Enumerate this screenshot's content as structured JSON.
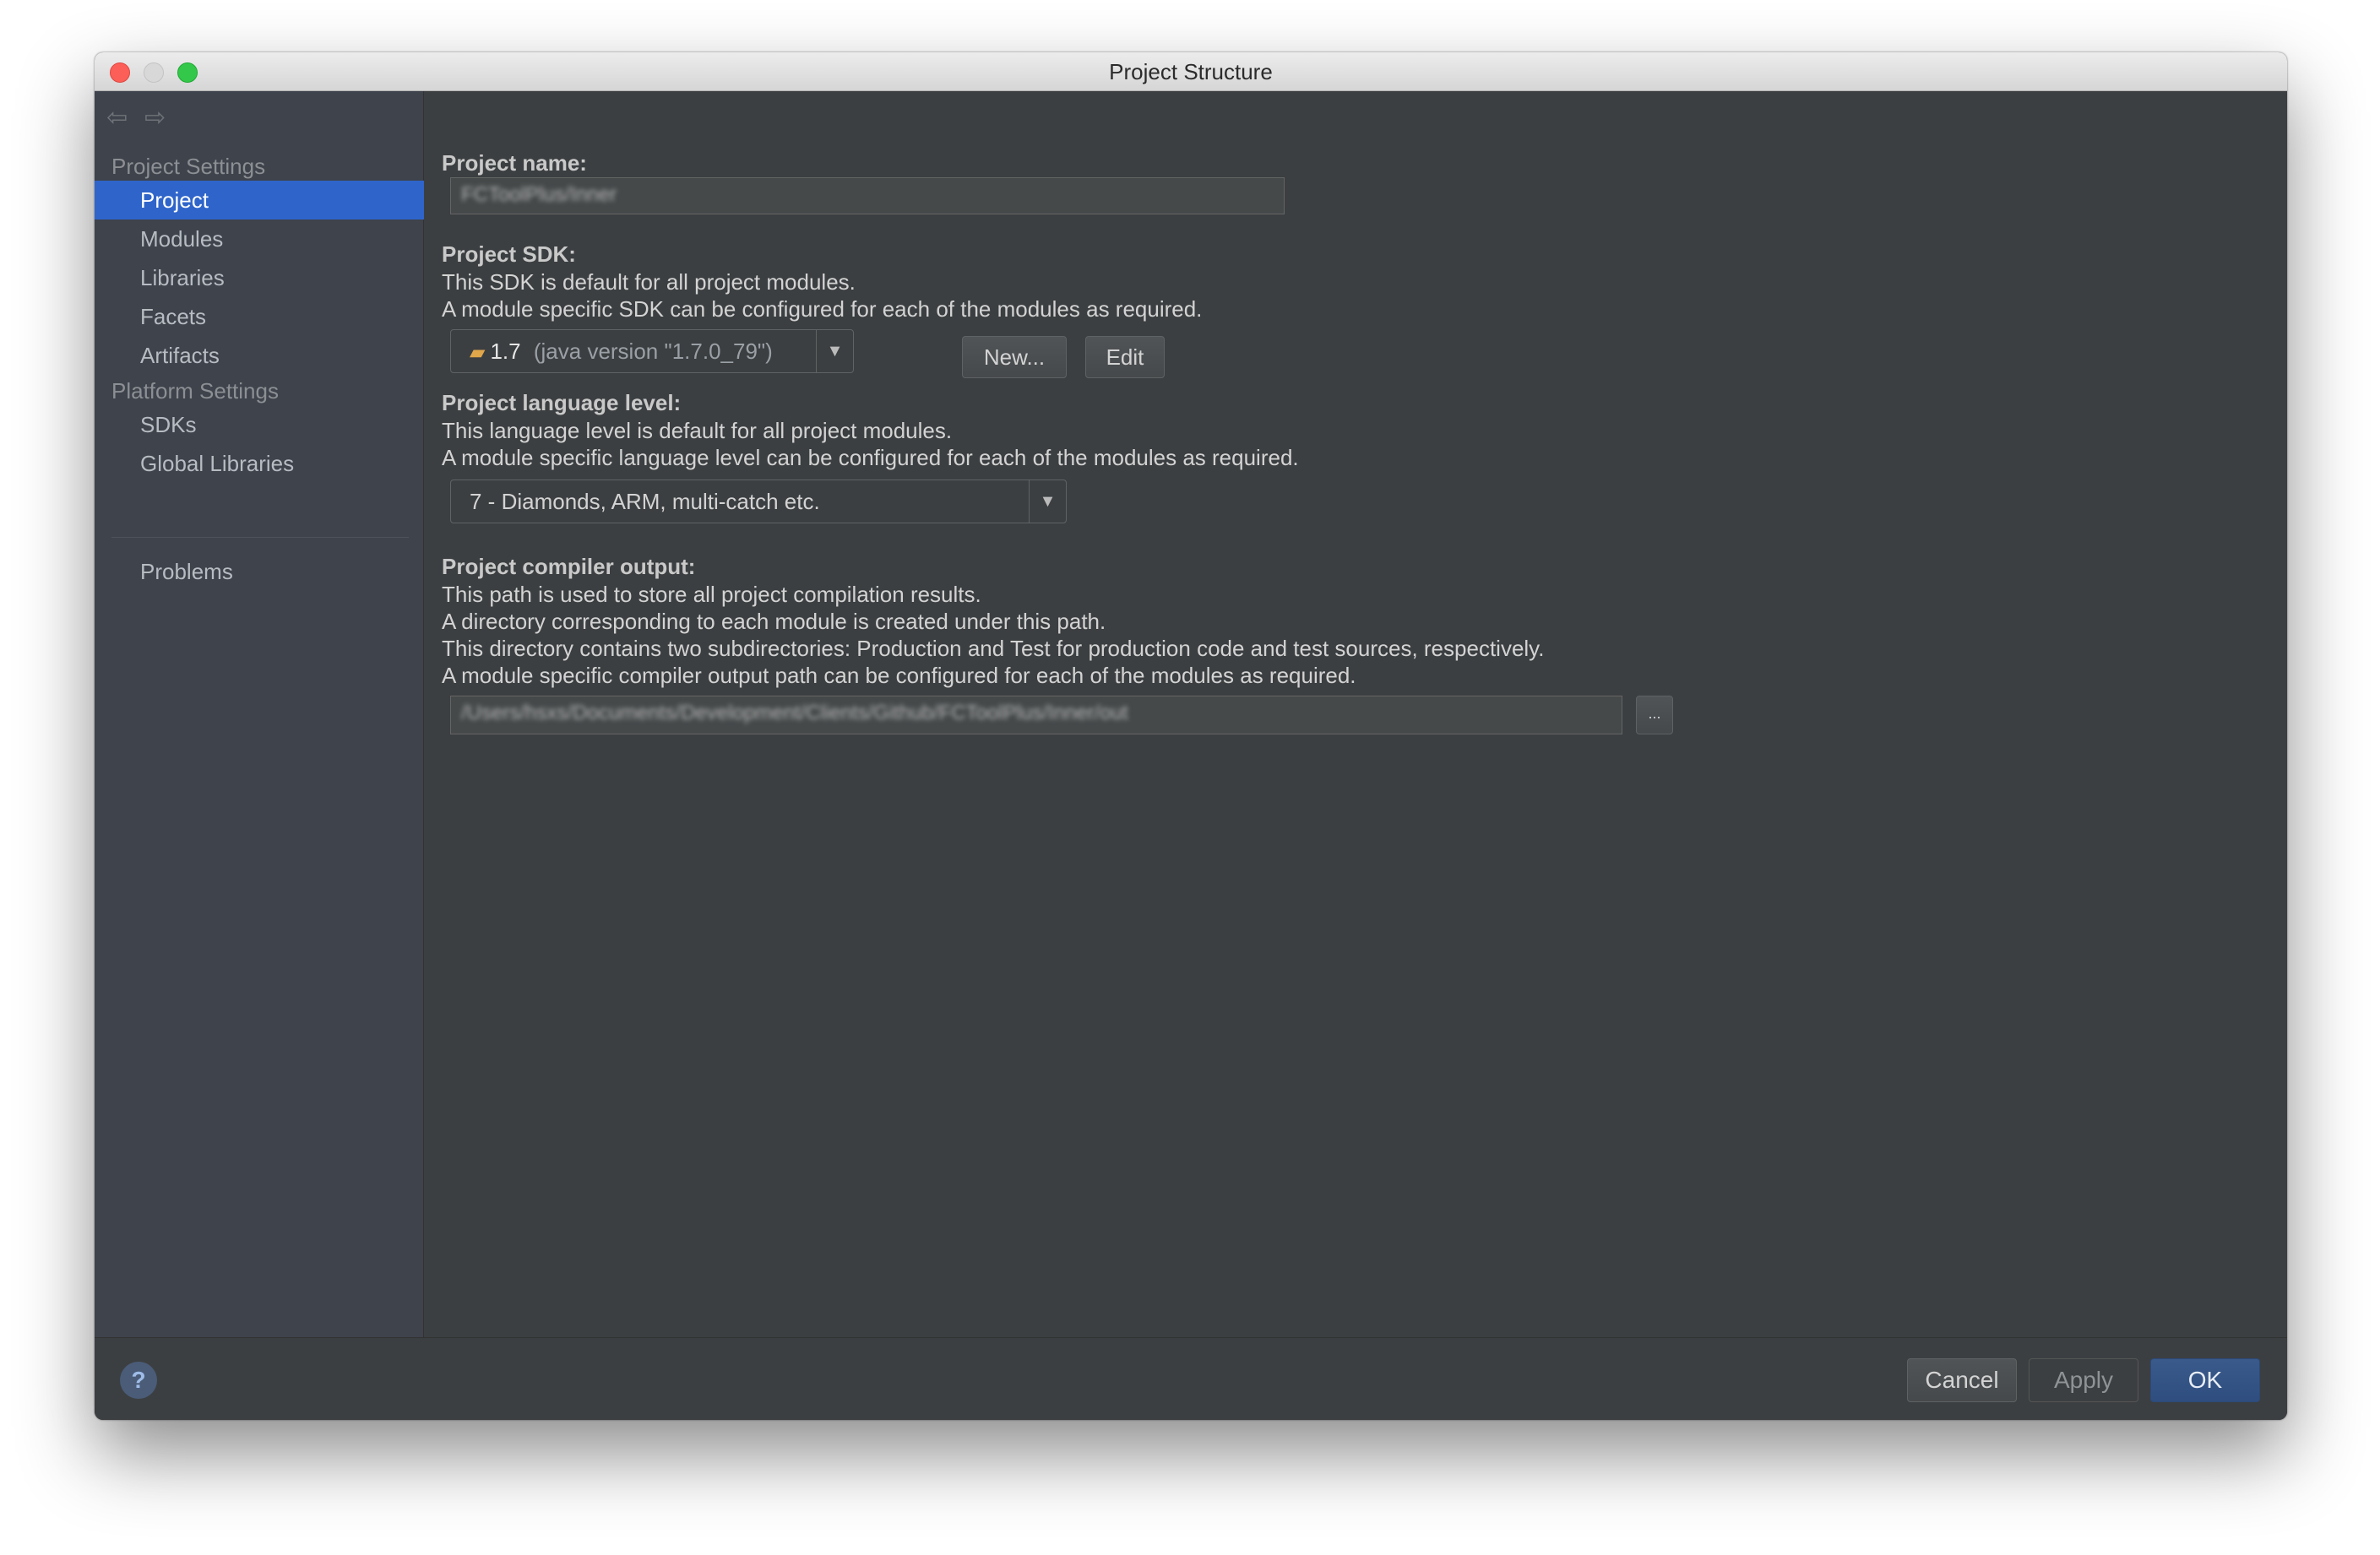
{
  "window": {
    "title": "Project Structure"
  },
  "nav": {
    "back_icon": "arrow-left-icon",
    "forward_icon": "arrow-right-icon"
  },
  "sidebar": {
    "section_project": "Project Settings",
    "project_items": [
      "Project",
      "Modules",
      "Libraries",
      "Facets",
      "Artifacts"
    ],
    "section_platform": "Platform Settings",
    "platform_items": [
      "SDKs",
      "Global Libraries"
    ],
    "problems": "Problems",
    "selected": "Project"
  },
  "main": {
    "project_name": {
      "label": "Project name:",
      "value": "FCToolPlus/Inner"
    },
    "sdk": {
      "label": "Project SDK:",
      "desc1": "This SDK is default for all project modules.",
      "desc2": "A module specific SDK can be configured for each of the modules as required.",
      "selected_main": "1.7",
      "selected_detail": "(java version \"1.7.0_79\")",
      "new_label": "New...",
      "edit_label": "Edit"
    },
    "language": {
      "label": "Project language level:",
      "desc1": "This language level is default for all project modules.",
      "desc2": "A module specific language level can be configured for each of the modules as required.",
      "selected": "7 - Diamonds, ARM, multi-catch etc."
    },
    "compiler": {
      "label": "Project compiler output:",
      "desc1": "This path is used to store all project compilation results.",
      "desc2": "A directory corresponding to each module is created under this path.",
      "desc3": "This directory contains two subdirectories: Production and Test for production code and test sources, respectively.",
      "desc4": "A module specific compiler output path can be configured for each of the modules as required.",
      "path": "/Users/hsxs/Documents/Development/Clients/Github/FCToolPlus/Inner/out",
      "browse": "..."
    }
  },
  "footer": {
    "help": "?",
    "cancel": "Cancel",
    "apply": "Apply",
    "ok": "OK"
  }
}
